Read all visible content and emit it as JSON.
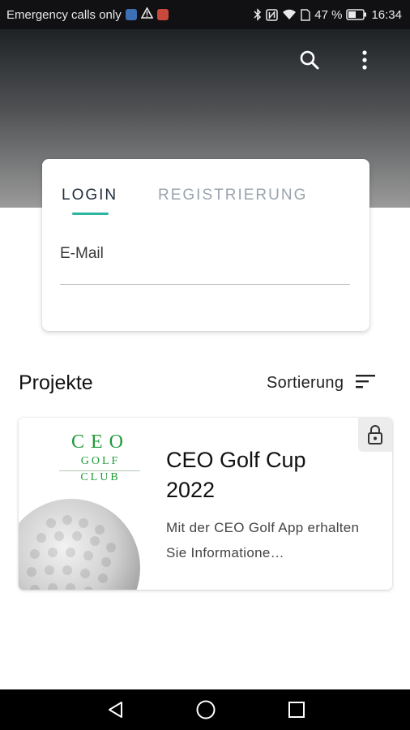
{
  "status_bar": {
    "carrier_text": "Emergency calls only",
    "battery_percent": "47 %",
    "time": "16:34",
    "icons": [
      "shield-icon",
      "warning-icon",
      "app-notification-icon",
      "bluetooth-icon",
      "nfc-icon",
      "wifi-icon",
      "sim-icon",
      "battery-icon"
    ]
  },
  "header": {
    "actions": [
      "search-icon",
      "more-vert-icon"
    ]
  },
  "auth_card": {
    "tab_login": "LOGIN",
    "tab_register": "REGISTRIERUNG",
    "active_tab": "LOGIN",
    "email_label": "E-Mail",
    "email_value": ""
  },
  "projects": {
    "title": "Projekte",
    "sort_label": "Sortierung",
    "items": [
      {
        "logo_line1": "CEO",
        "logo_line2": "GOLF",
        "logo_line3": "CLUB",
        "title": "CEO Golf Cup 2022",
        "description": "Mit der CEO Golf App erhalten Sie Informatione…",
        "locked": true
      }
    ]
  },
  "nav_bar": {
    "buttons": [
      "back-icon",
      "home-icon",
      "recents-icon"
    ]
  },
  "colors": {
    "accent": "#2bb5a3",
    "logo_green": "#1f9a3a"
  }
}
